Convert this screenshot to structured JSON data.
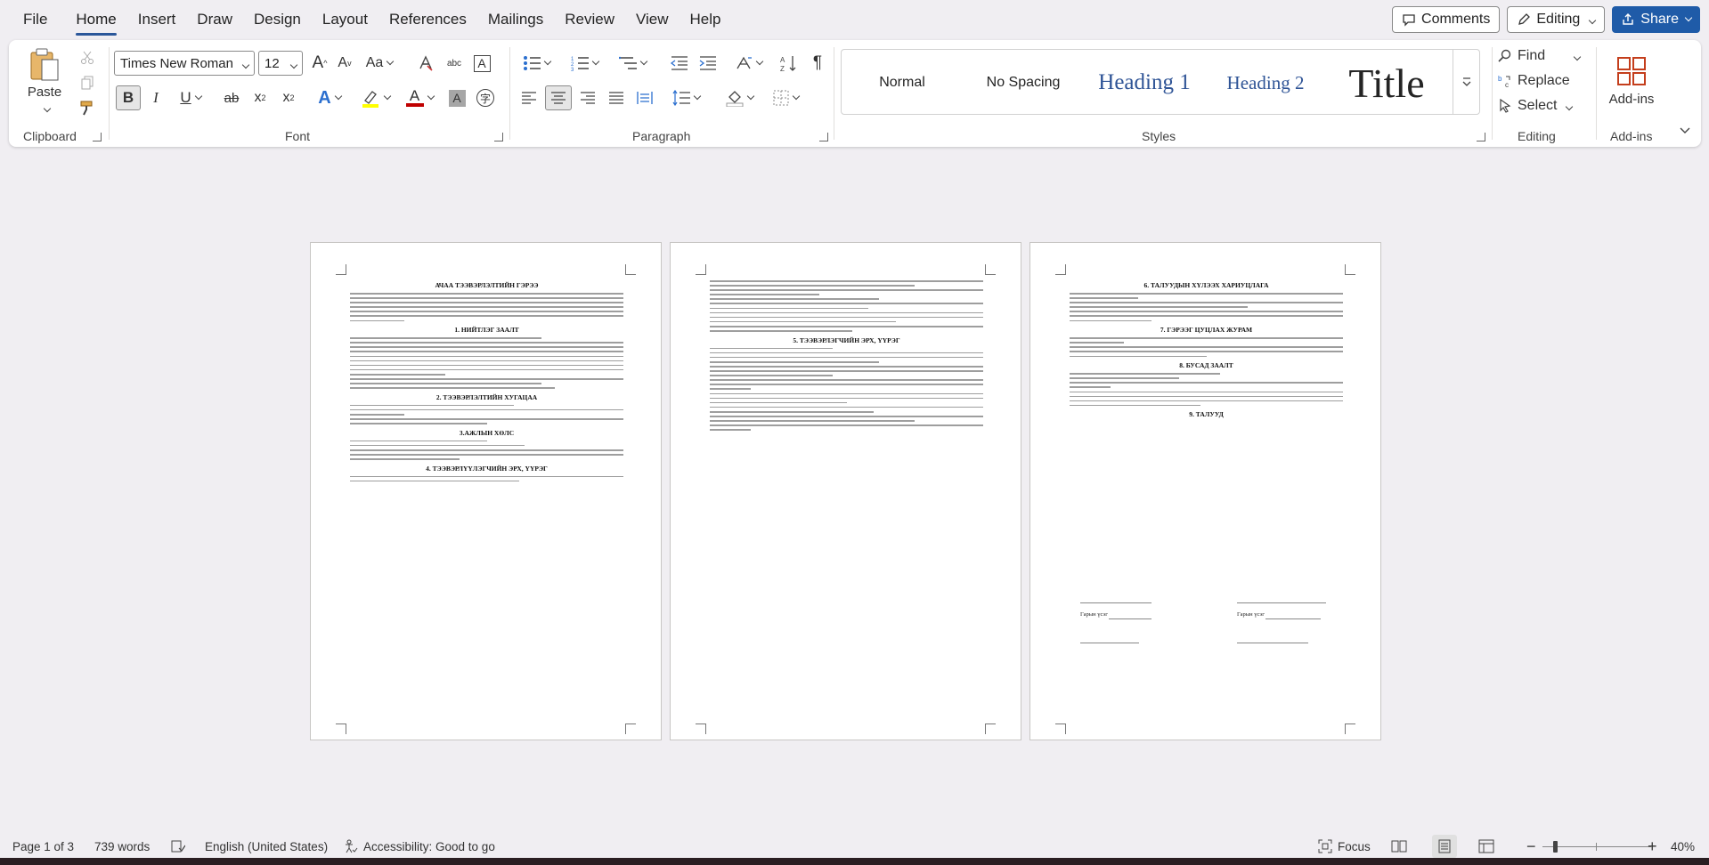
{
  "menu": {
    "tabs": [
      "File",
      "Home",
      "Insert",
      "Draw",
      "Design",
      "Layout",
      "References",
      "Mailings",
      "Review",
      "View",
      "Help"
    ],
    "active": "Home",
    "comments_label": "Comments",
    "editing_label": "Editing",
    "share_label": "Share"
  },
  "ribbon": {
    "clipboard": {
      "label": "Clipboard",
      "paste_label": "Paste"
    },
    "font": {
      "label": "Font",
      "font_name": "Times New Roman",
      "font_size": "12",
      "case_label": "Aa"
    },
    "paragraph": {
      "label": "Paragraph"
    },
    "styles": {
      "label": "Styles",
      "items": [
        {
          "name": "Normal"
        },
        {
          "name": "No Spacing"
        },
        {
          "name": "Heading 1"
        },
        {
          "name": "Heading 2"
        },
        {
          "name": "Title"
        }
      ]
    },
    "editing": {
      "label": "Editing",
      "find_label": "Find",
      "replace_label": "Replace",
      "select_label": "Select"
    },
    "addins": {
      "label": "Add-ins",
      "button_label": "Add-ins"
    }
  },
  "document": {
    "pages": [
      {
        "title": "АЧАА ТЭЭВЭРЛЭЛТИЙН ГЭРЭЭ",
        "headings": [
          "1. НИЙТЛЭГ ЗААЛТ",
          "2. ТЭЭВЭРЛЭЛТИЙН ХУГАЦАА",
          "3.АЖЛЫН ХӨЛС",
          "4. ТЭЭВЭРЛҮҮЛЭГЧИЙН ЭРХ, ҮҮРЭГ"
        ]
      },
      {
        "headings": [
          "5. ТЭЭВЭРЛЭГЧИЙН ЭРХ, ҮҮРЭГ"
        ]
      },
      {
        "headings": [
          "6. ТАЛУУДЫН ХҮЛЭЭХ ХАРИУЦЛАГА",
          "7. ГЭРЭЭГ ЦУЦЛАХ ЖУРАМ",
          "8. БУСАД ЗААЛТ",
          "9. ТАЛУУД"
        ],
        "signatures": {
          "left": "Гарын үсэг",
          "right": "Гарын үсэг"
        }
      }
    ]
  },
  "status": {
    "page": "Page 1 of 3",
    "words": "739 words",
    "language": "English (United States)",
    "accessibility": "Accessibility: Good to go",
    "focus": "Focus",
    "zoom": "40%"
  },
  "colors": {
    "accent": "#2b579a",
    "share": "#1f5ba8",
    "heading": "#2f5496",
    "highlight": "#ffff00",
    "font_color": "#c00000"
  }
}
